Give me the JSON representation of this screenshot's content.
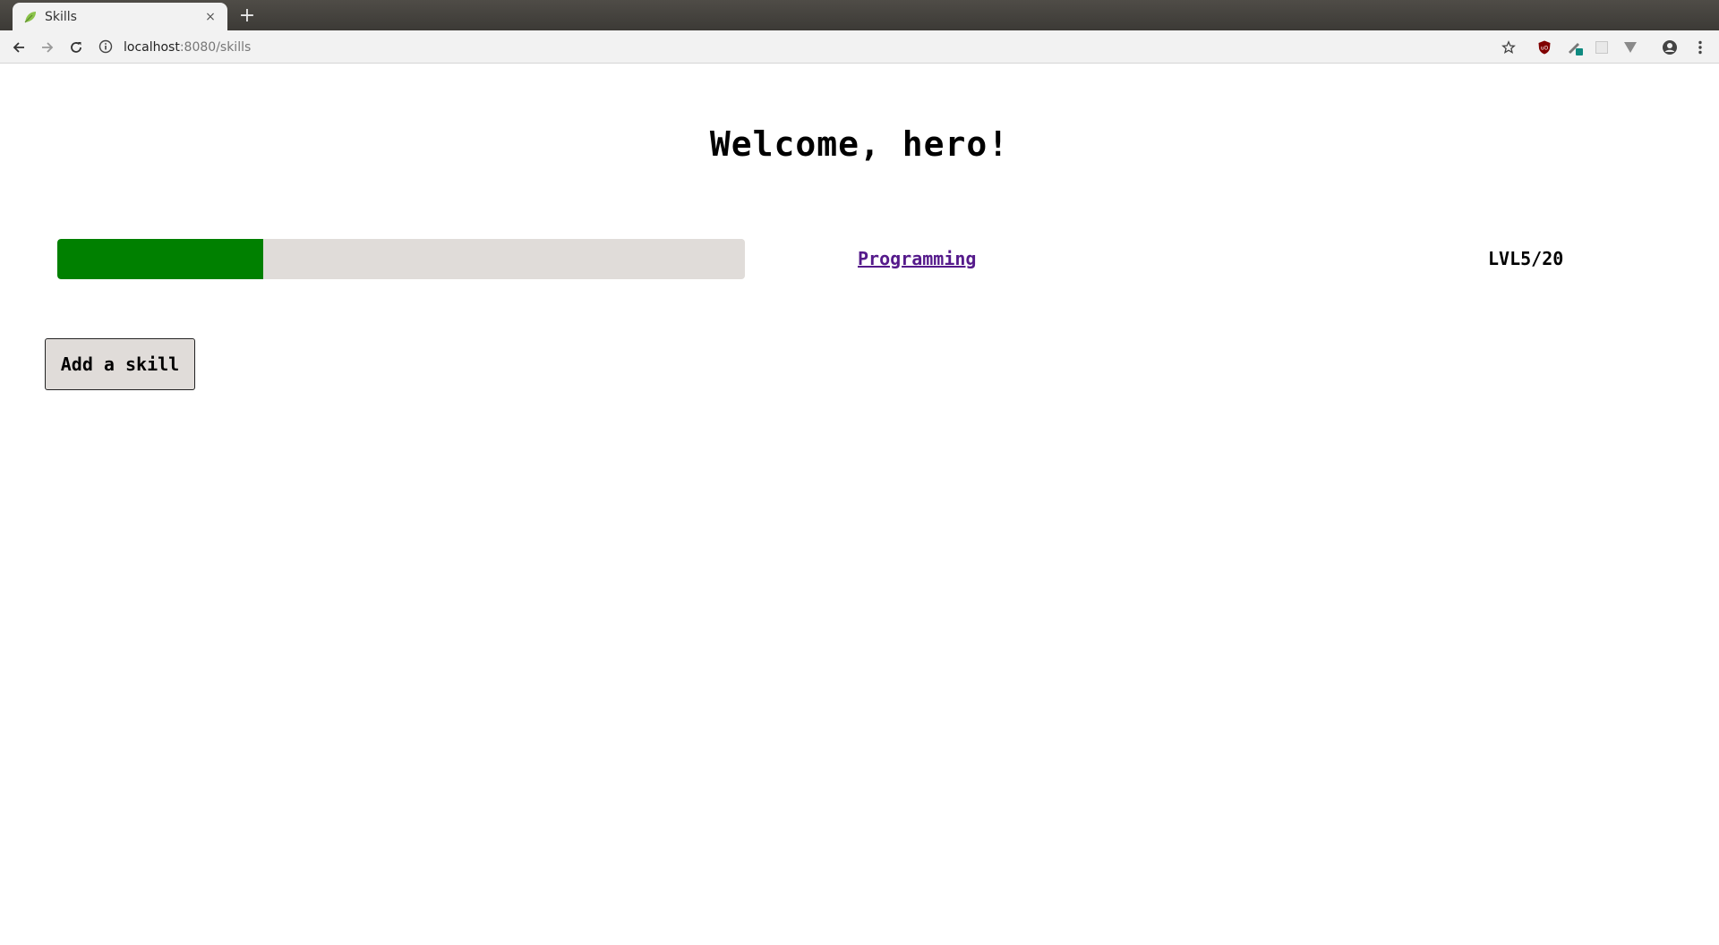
{
  "browser": {
    "tab_title": "Skills",
    "tab_close": "×",
    "new_tab": "+",
    "url_host": "localhost",
    "url_rest": ":8080/skills"
  },
  "page": {
    "title": "Welcome, hero!",
    "add_button": "Add a skill"
  },
  "skills": [
    {
      "name": "Programming",
      "level_text": "LVL5/20",
      "progress": 0.3,
      "progress_color": "#008000"
    }
  ],
  "colors": {
    "track": "#e0dcd9",
    "link": "#551a8b"
  },
  "icons": [
    "leaf-favicon-icon",
    "back-arrow-icon",
    "forward-arrow-icon",
    "reload-icon",
    "info-icon",
    "star-icon",
    "ublock-icon",
    "extension-pen-icon",
    "extension-square-icon",
    "extension-v-icon",
    "profile-icon",
    "menu-icon"
  ]
}
